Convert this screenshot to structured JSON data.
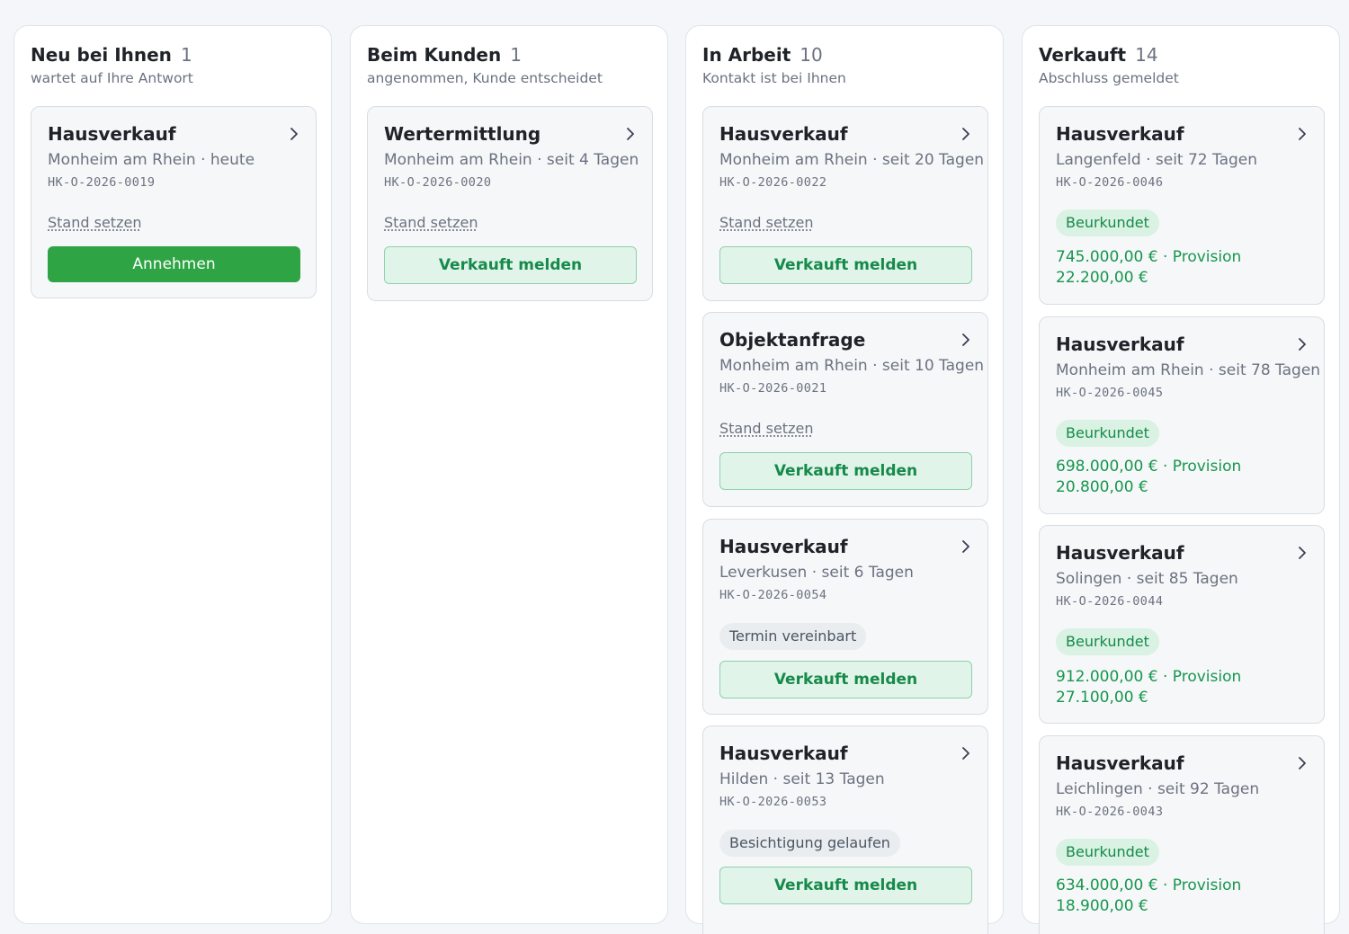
{
  "columns": [
    {
      "title": "Neu bei Ihnen",
      "count": "1",
      "subtitle": "wartet auf Ihre Antwort",
      "cards": [
        {
          "title": "Hausverkauf",
          "location": "Monheim am Rhein",
          "age": "heute",
          "id": "HK-O-2026-0019",
          "stand_link": "Stand setzen",
          "button": "Annehmen"
        }
      ]
    },
    {
      "title": "Beim Kunden",
      "count": "1",
      "subtitle": "angenommen, Kunde entscheidet",
      "cards": [
        {
          "title": "Wertermittlung",
          "location": "Monheim am Rhein",
          "age": "seit 4 Tagen",
          "id": "HK-O-2026-0020",
          "stand_link": "Stand setzen",
          "button": "Verkauft melden"
        }
      ]
    },
    {
      "title": "In Arbeit",
      "count": "10",
      "subtitle": "Kontakt ist bei Ihnen",
      "cards": [
        {
          "title": "Hausverkauf",
          "location": "Monheim am Rhein",
          "age": "seit 20 Tagen",
          "id": "HK-O-2026-0022",
          "stand_link": "Stand setzen",
          "button": "Verkauft melden"
        },
        {
          "title": "Objektanfrage",
          "location": "Monheim am Rhein",
          "age": "seit 10 Tagen",
          "id": "HK-O-2026-0021",
          "stand_link": "Stand setzen",
          "button": "Verkauft melden"
        },
        {
          "title": "Hausverkauf",
          "location": "Leverkusen",
          "age": "seit 6 Tagen",
          "id": "HK-O-2026-0054",
          "status": "Termin vereinbart",
          "button": "Verkauft melden"
        },
        {
          "title": "Hausverkauf",
          "location": "Hilden",
          "age": "seit 13 Tagen",
          "id": "HK-O-2026-0053",
          "status": "Besichtigung gelaufen",
          "button": "Verkauft melden"
        }
      ]
    },
    {
      "title": "Verkauft",
      "count": "14",
      "subtitle": "Abschluss gemeldet",
      "cards": [
        {
          "title": "Hausverkauf",
          "location": "Langenfeld",
          "age": "seit 72 Tagen",
          "id": "HK-O-2026-0046",
          "badge": "Beurkundet",
          "price": "745.000,00 €",
          "provision": "22.200,00 €"
        },
        {
          "title": "Hausverkauf",
          "location": "Monheim am Rhein",
          "age": "seit 78 Tagen",
          "id": "HK-O-2026-0045",
          "badge": "Beurkundet",
          "price": "698.000,00 €",
          "provision": "20.800,00 €"
        },
        {
          "title": "Hausverkauf",
          "location": "Solingen",
          "age": "seit 85 Tagen",
          "id": "HK-O-2026-0044",
          "badge": "Beurkundet",
          "price": "912.000,00 €",
          "provision": "27.100,00 €"
        },
        {
          "title": "Hausverkauf",
          "location": "Leichlingen",
          "age": "seit 92 Tagen",
          "id": "HK-O-2026-0043",
          "badge": "Beurkundet",
          "price": "634.000,00 €",
          "provision": "18.900,00 €"
        }
      ]
    }
  ],
  "labels": {
    "separator": "·",
    "provision": "Provision"
  },
  "icons": {
    "card_open": "chevron-right-icon"
  },
  "colors": {
    "primary_green": "#2ea444",
    "success_text": "#16964d",
    "muted_text": "#6b7280"
  }
}
